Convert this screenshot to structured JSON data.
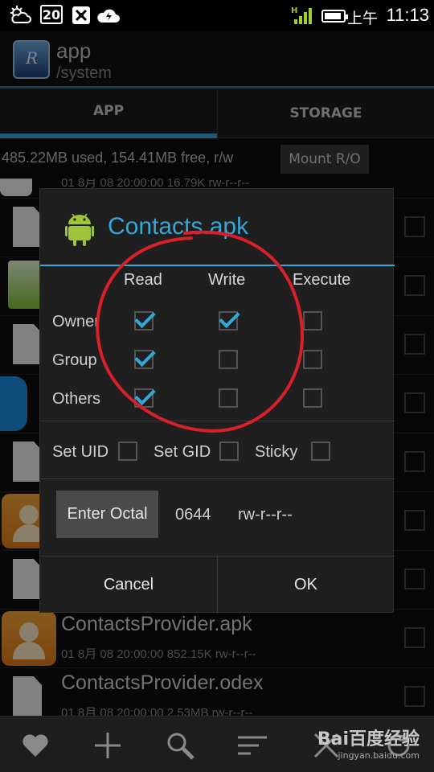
{
  "status_bar": {
    "date": "20",
    "ampm": "上午",
    "time": "11:13",
    "signal_type": "H",
    "icons": [
      "weather-icon",
      "calendar-date-icon",
      "usb-debug-icon",
      "cloud-sync-icon",
      "signal-icon",
      "battery-icon"
    ]
  },
  "app_header": {
    "title": "app",
    "path": "/system"
  },
  "tabs": [
    {
      "label": "APP",
      "selected": true
    },
    {
      "label": "STORAGE",
      "selected": false
    }
  ],
  "storage": {
    "info": "485.22MB used, 154.41MB free, r/w",
    "mount_button": "Mount R/O"
  },
  "file_list": [
    {
      "name": "",
      "meta": "01 8月 08 20:00:00  16.79K  rw-r--r--",
      "icon": "red-app-icon"
    },
    {
      "name": "",
      "meta": "",
      "icon": "file-icon"
    },
    {
      "name": "",
      "meta": "",
      "icon": "android-app-icon"
    },
    {
      "name": "",
      "meta": "",
      "icon": "file-icon"
    },
    {
      "name": "",
      "meta": "",
      "icon": "robot-app-icon"
    },
    {
      "name": "",
      "meta": "",
      "icon": "file-icon"
    },
    {
      "name": "",
      "meta": "",
      "icon": "contacts-app-icon"
    },
    {
      "name": "",
      "meta": "",
      "icon": "file-icon"
    },
    {
      "name": "ContactsProvider.apk",
      "meta": "01 8月 08 20:00:00  852.15K  rw-r--r--",
      "icon": "contacts-app-icon"
    },
    {
      "name": "ContactsProvider.odex",
      "meta": "01 8月 08 20:00:00  2.53MB  rw-r--r--",
      "icon": "file-icon"
    }
  ],
  "dialog": {
    "title": "Contacts.apk",
    "columns": [
      "Read",
      "Write",
      "Execute"
    ],
    "rows": [
      {
        "label": "Owner",
        "read": true,
        "write": true,
        "execute": false
      },
      {
        "label": "Group",
        "read": true,
        "write": false,
        "execute": false
      },
      {
        "label": "Others",
        "read": true,
        "write": false,
        "execute": false
      }
    ],
    "flags": [
      {
        "label": "Set UID",
        "checked": false
      },
      {
        "label": "Set GID",
        "checked": false
      },
      {
        "label": "Sticky",
        "checked": false
      }
    ],
    "octal_button": "Enter Octal",
    "octal_value": "0644",
    "octal_permissions": "rw-r--r--",
    "cancel_label": "Cancel",
    "ok_label": "OK"
  },
  "toolbar": {
    "icons": [
      "favorite-icon",
      "add-icon",
      "search-icon",
      "sort-icon",
      "close-icon",
      "refresh-icon"
    ]
  },
  "watermark": {
    "main": "Bai百度经验",
    "sub": "jingyan.baidu.com"
  },
  "colors": {
    "accent": "#34a6d8",
    "annotation": "#d8202a",
    "android_green": "#9fc33b"
  }
}
